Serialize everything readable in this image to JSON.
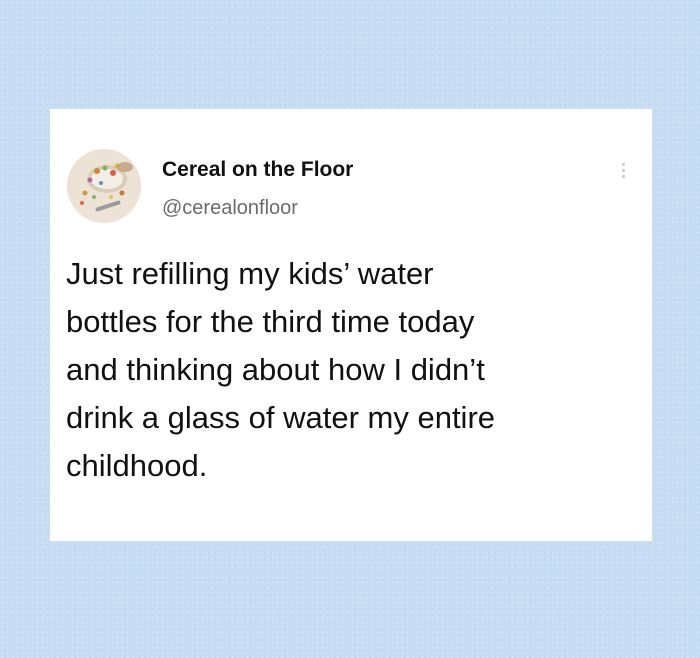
{
  "tweet": {
    "author": {
      "display_name": "Cereal on the Floor",
      "handle": "@cerealonfloor",
      "avatar_icon": "cereal-bowl-avatar"
    },
    "more_icon": "vertical-ellipsis-icon",
    "text": "Just refilling my kids’ water\nbottles for the third time today\nand thinking about how I didn’t\ndrink a glass of water my entire\nchildhood."
  },
  "colors": {
    "background": "#c6dcf2",
    "card": "#ffffff",
    "text_primary": "#111111",
    "text_secondary": "#6b6b6b"
  }
}
